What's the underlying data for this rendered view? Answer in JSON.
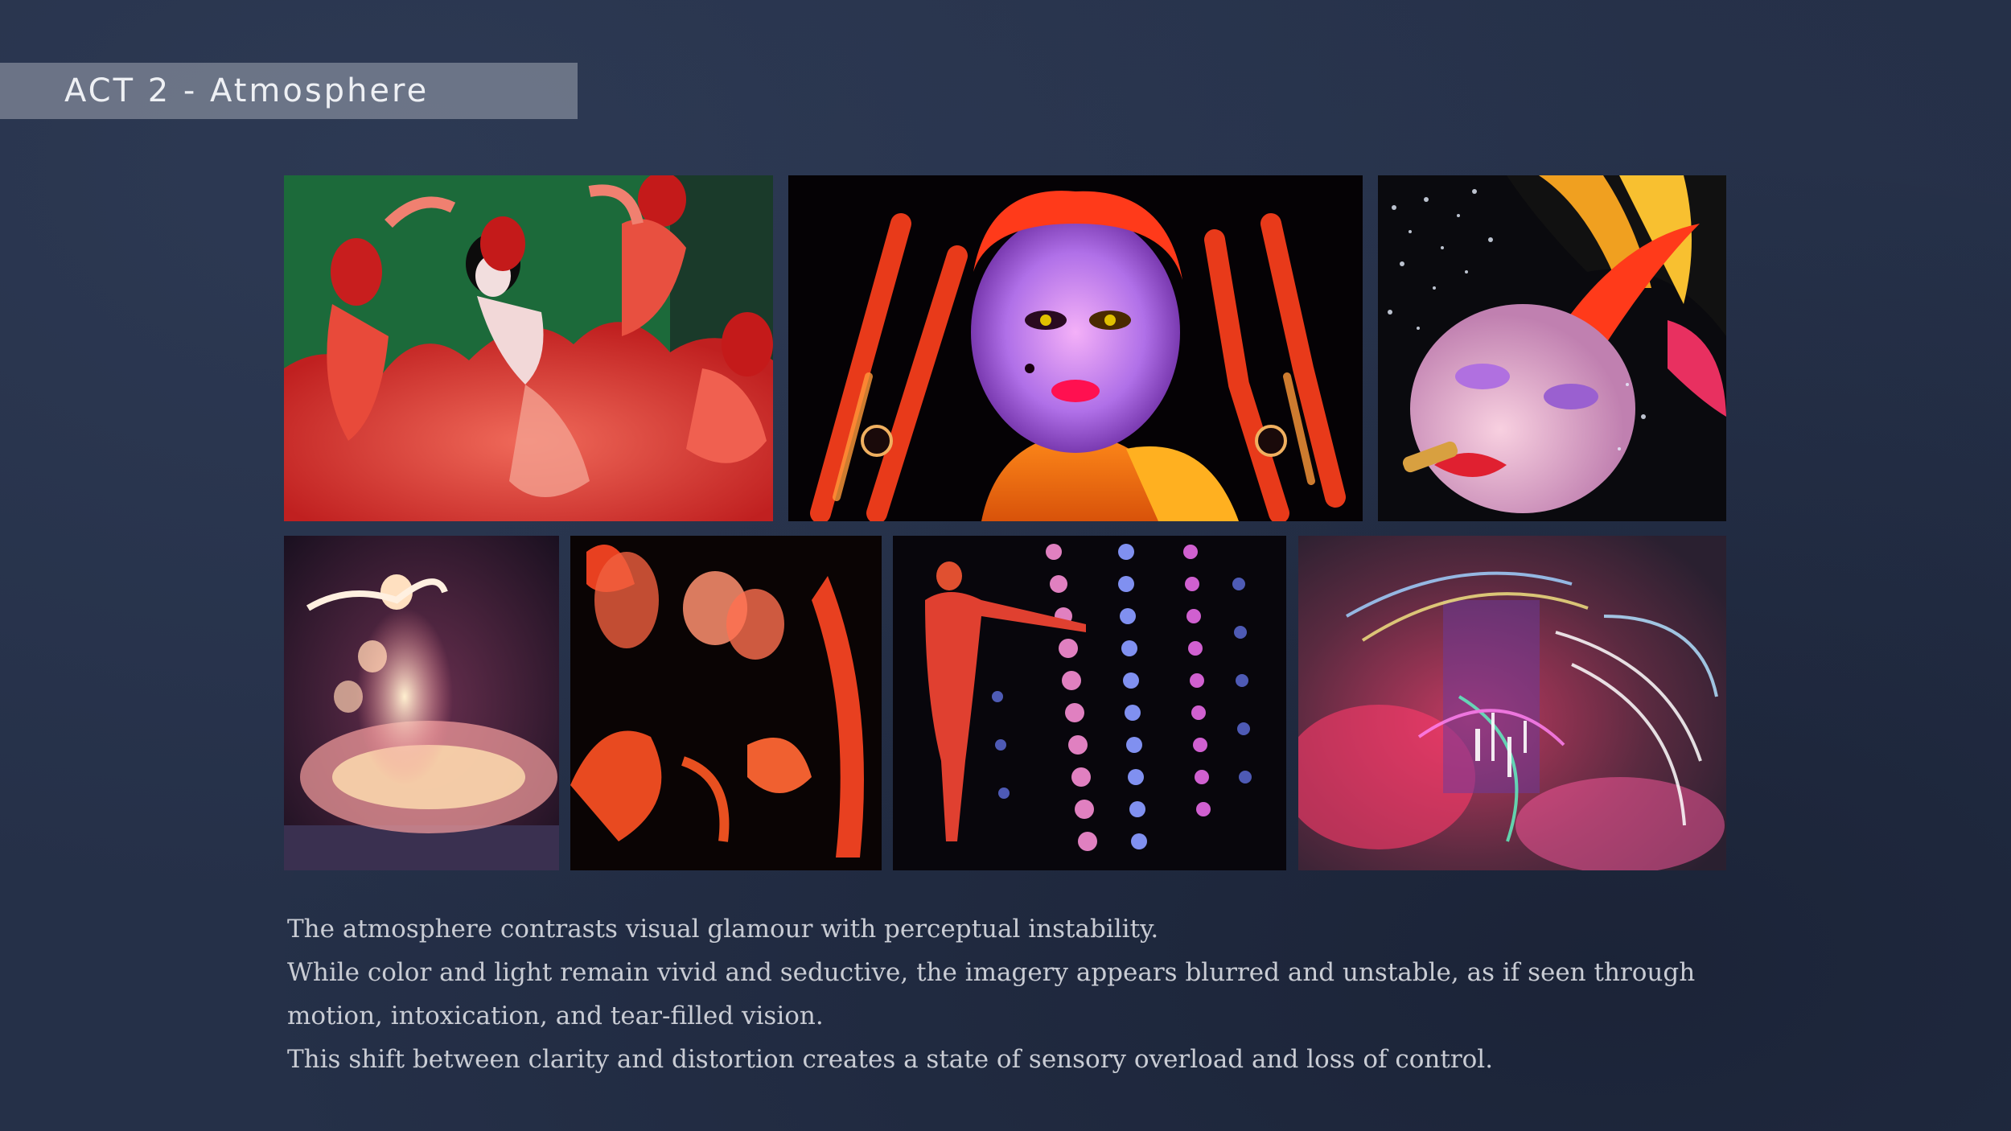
{
  "header": {
    "title": "ACT 2 - Atmosphere"
  },
  "gallery": {
    "row1": [
      {
        "subject": "red-masked-dancers",
        "palette": "red-green"
      },
      {
        "subject": "glowing-face-with-spider-legs",
        "palette": "red-purple-orange"
      },
      {
        "subject": "woman-with-feathered-hat-applying-lipstick",
        "palette": "pink-yellow-black"
      }
    ],
    "row2": [
      {
        "subject": "blurred-spinning-dancer",
        "palette": "pink-gold"
      },
      {
        "subject": "motion-blurred-figures",
        "palette": "red-black"
      },
      {
        "subject": "figure-among-bead-curtains",
        "palette": "red-blue-black"
      },
      {
        "subject": "abstract-prismatic-light-streaks",
        "palette": "pink-rainbow"
      }
    ]
  },
  "caption": {
    "line1": "The atmosphere contrasts visual glamour with perceptual instability.",
    "line2": "While color and light remain vivid and seductive, the imagery appears blurred and unstable, as if seen through",
    "line3": "motion, intoxication, and tear-filled vision.",
    "line4": "This shift between clarity and distortion creates a state of sensory overload and loss of control."
  },
  "colors": {
    "background": "#253048",
    "title_bar": "#a0a6b2",
    "caption_text": "#c9ccd4"
  }
}
